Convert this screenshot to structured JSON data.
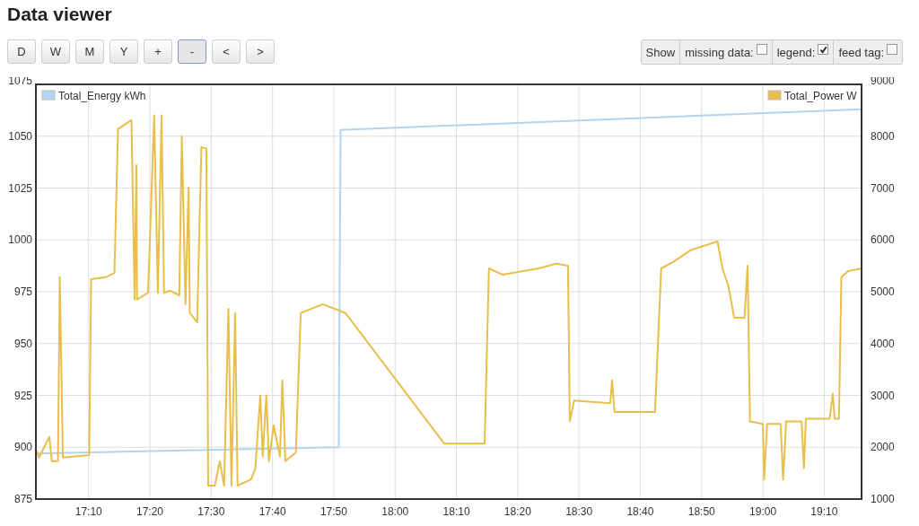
{
  "title": "Data viewer",
  "range_buttons": [
    {
      "label": "D",
      "selected": false
    },
    {
      "label": "W",
      "selected": false
    },
    {
      "label": "M",
      "selected": false
    },
    {
      "label": "Y",
      "selected": false
    },
    {
      "label": "+",
      "selected": false
    },
    {
      "label": "-",
      "selected": true
    },
    {
      "label": "<",
      "selected": false
    },
    {
      "label": ">",
      "selected": false
    }
  ],
  "show_options": {
    "label": "Show",
    "options": [
      {
        "label": "missing data:",
        "checked": false
      },
      {
        "label": "legend:",
        "checked": true
      },
      {
        "label": "feed tag:",
        "checked": false
      }
    ]
  },
  "chart_data": {
    "type": "line",
    "grid": true,
    "legend": "top",
    "xlim": [
      17.0233,
      19.2683
    ],
    "ylim": [
      875,
      1075
    ],
    "yticks": [
      875,
      900,
      925,
      950,
      975,
      1000,
      1025,
      1050,
      1075
    ],
    "y2lim": [
      1000,
      9000
    ],
    "y2ticks": [
      1000,
      2000,
      3000,
      4000,
      5000,
      6000,
      7000,
      8000,
      9000
    ],
    "xticks": [
      {
        "value": 17.1667,
        "label": "17:10"
      },
      {
        "value": 17.3333,
        "label": "17:20"
      },
      {
        "value": 17.5,
        "label": "17:30"
      },
      {
        "value": 17.6667,
        "label": "17:40"
      },
      {
        "value": 17.8333,
        "label": "17:50"
      },
      {
        "value": 18,
        "label": "18:00"
      },
      {
        "value": 18.1667,
        "label": "18:10"
      },
      {
        "value": 18.3333,
        "label": "18:20"
      },
      {
        "value": 18.5,
        "label": "18:30"
      },
      {
        "value": 18.6667,
        "label": "18:40"
      },
      {
        "value": 18.8333,
        "label": "18:50"
      },
      {
        "value": 19,
        "label": "19:00"
      },
      {
        "value": 19.1667,
        "label": "19:10"
      }
    ],
    "series": [
      {
        "name": "Total_Energy kWh",
        "color": "#b3d4ee",
        "x": [
          17.0233,
          17.8467,
          17.8517,
          19.2683
        ],
        "values": [
          897,
          900,
          1053,
          1063
        ]
      },
      {
        "name": "Total_Power W",
        "color": "#e8bf4a",
        "axis": "y2",
        "x": [
          17.0233,
          17.0317,
          17.06,
          17.0667,
          17.0833,
          17.0883,
          17.0967,
          17.1683,
          17.1733,
          17.2133,
          17.2367,
          17.2467,
          17.2833,
          17.2917,
          17.2967,
          17.2983,
          17.3283,
          17.345,
          17.355,
          17.365,
          17.3717,
          17.3883,
          17.4133,
          17.42,
          17.43,
          17.4383,
          17.4417,
          17.4617,
          17.4733,
          17.4867,
          17.4917,
          17.51,
          17.5233,
          17.535,
          17.5467,
          17.555,
          17.565,
          17.5717,
          17.6083,
          17.62,
          17.6333,
          17.64,
          17.65,
          17.6567,
          17.67,
          17.6867,
          17.6933,
          17.7017,
          17.73,
          17.7433,
          17.8033,
          17.8467,
          17.865,
          18.1333,
          18.2433,
          18.255,
          18.2917,
          18.39,
          18.4383,
          18.47,
          18.475,
          18.4867,
          18.585,
          18.59,
          18.5967,
          18.7067,
          18.7233,
          18.755,
          18.8033,
          18.8767,
          18.89,
          18.9067,
          18.9217,
          18.95,
          18.9583,
          18.965,
          19.0,
          19.0033,
          19.0117,
          19.0483,
          19.055,
          19.0633,
          19.105,
          19.1117,
          19.1167,
          19.1817,
          19.19,
          19.195,
          19.2067,
          19.2133,
          19.2317,
          19.2683
        ],
        "values": [
          1950,
          1800,
          2200,
          1730,
          1730,
          5280,
          1800,
          1850,
          5240,
          5280,
          5360,
          8140,
          8310,
          4850,
          7440,
          4850,
          4980,
          8400,
          4980,
          8400,
          4980,
          5020,
          4930,
          8000,
          4760,
          7010,
          4590,
          4410,
          7790,
          7760,
          1260,
          1260,
          1730,
          1260,
          4670,
          1260,
          4590,
          1260,
          1380,
          1590,
          3000,
          1820,
          3000,
          1730,
          2420,
          1820,
          3290,
          1730,
          1900,
          4590,
          4760,
          4640,
          4590,
          2070,
          2070,
          5450,
          5330,
          5450,
          5540,
          5500,
          2500,
          2900,
          2850,
          3290,
          2680,
          2680,
          5450,
          5570,
          5800,
          5970,
          5450,
          5100,
          4500,
          4500,
          5500,
          2500,
          2450,
          1380,
          2450,
          2450,
          1380,
          2500,
          2500,
          1600,
          2550,
          2550,
          3030,
          2550,
          2550,
          5280,
          5400,
          5450
        ]
      }
    ]
  }
}
